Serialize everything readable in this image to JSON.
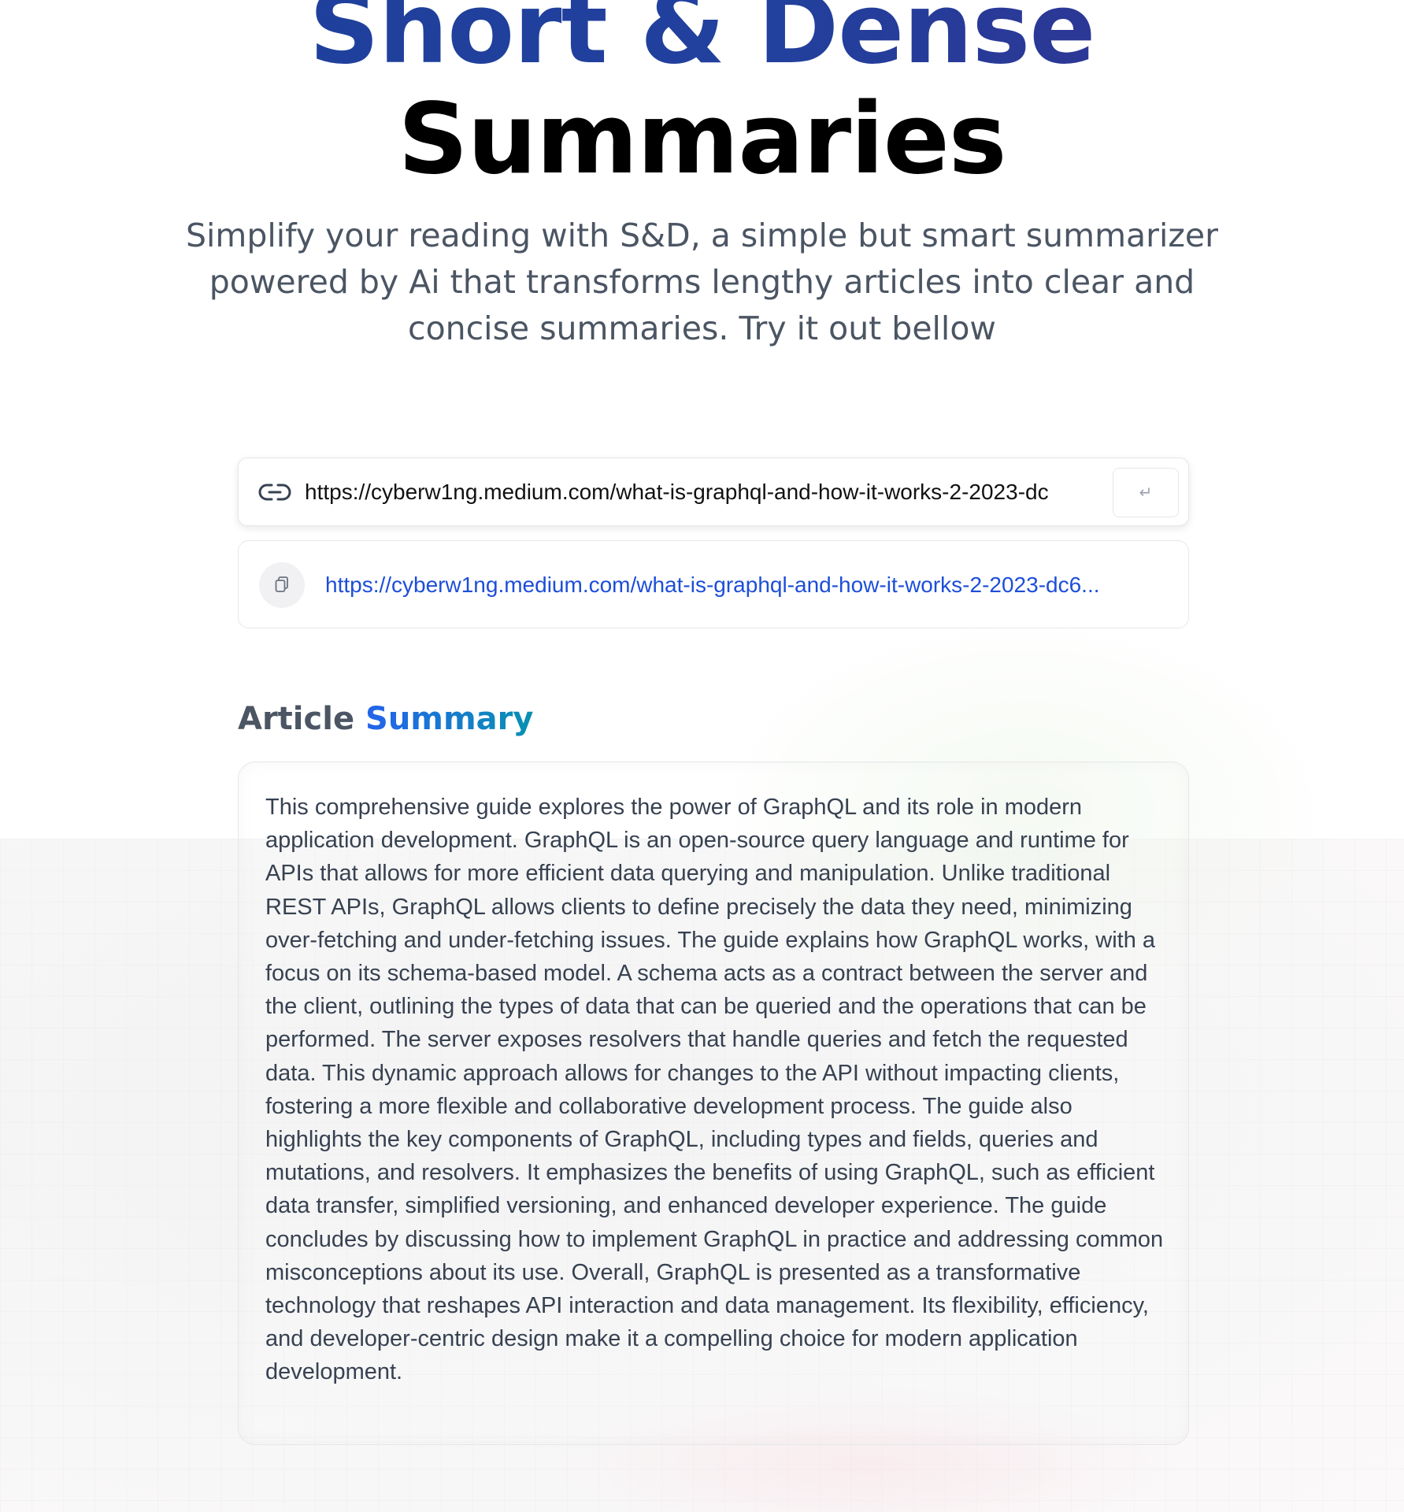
{
  "hero": {
    "title_line1": "Short & Dense",
    "title_line2": "Summaries",
    "subtitle": "Simplify your reading with S&D, a simple but smart summarizer powered by Ai that transforms lengthy articles into clear and concise summaries. Try it out bellow"
  },
  "url_form": {
    "icon": "link-icon",
    "value": "https://cyberw1ng.medium.com/what-is-graphql-and-how-it-works-2-2023-dc",
    "submit_icon": "enter-icon",
    "submit_label": "↵"
  },
  "history": [
    {
      "icon": "copy-icon",
      "url": "https://cyberw1ng.medium.com/what-is-graphql-and-how-it-works-2-2023-dc6..."
    }
  ],
  "summary": {
    "heading_prefix": "Article",
    "heading_accent": "Summary",
    "text": "This comprehensive guide explores the power of GraphQL and its role in modern application development. GraphQL is an open-source query language and runtime for APIs that allows for more efficient data querying and manipulation. Unlike traditional REST APIs, GraphQL allows clients to define precisely the data they need, minimizing over-fetching and under-fetching issues. The guide explains how GraphQL works, with a focus on its schema-based model. A schema acts as a contract between the server and the client, outlining the types of data that can be queried and the operations that can be performed. The server exposes resolvers that handle queries and fetch the requested data. This dynamic approach allows for changes to the API without impacting clients, fostering a more flexible and collaborative development process. The guide also highlights the key components of GraphQL, including types and fields, queries and mutations, and resolvers. It emphasizes the benefits of using GraphQL, such as efficient data transfer, simplified versioning, and enhanced developer experience. The guide concludes by discussing how to implement GraphQL in practice and addressing common misconceptions about its use. Overall, GraphQL is presented as a transformative technology that reshapes API interaction and data management. Its flexibility, efficiency, and developer-centric design make it a compelling choice for modern application development."
  },
  "colors": {
    "title_gradient_start": "#1d3f9c",
    "title_gradient_end": "#352f8e",
    "link": "#1d4ed8",
    "accent_gradient_start": "#2563eb",
    "accent_gradient_end": "#0891b2"
  }
}
